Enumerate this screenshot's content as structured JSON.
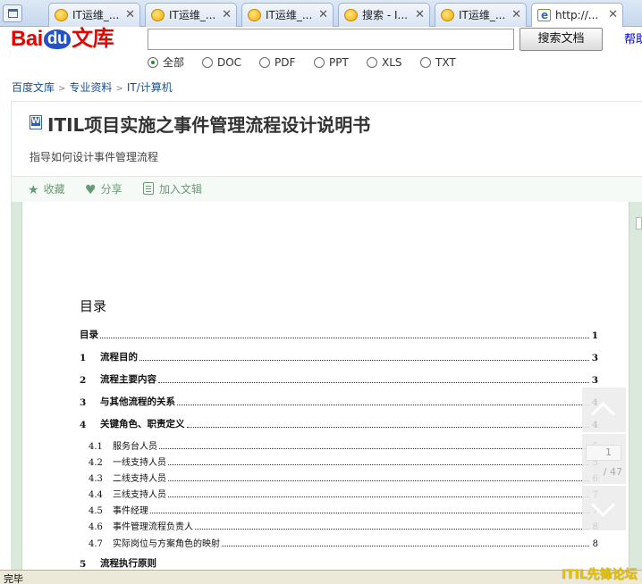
{
  "browser": {
    "tabs": [
      {
        "label": "IT运维_...",
        "icon": "baidu-paw-icon",
        "close": "✕"
      },
      {
        "label": "IT运维_...",
        "icon": "baidu-paw-icon",
        "close": "✕"
      },
      {
        "label": "IT运维_...",
        "icon": "baidu-paw-icon",
        "close": "✕"
      },
      {
        "label": "搜索 - I...",
        "icon": "baidu-paw-icon",
        "close": "✕"
      },
      {
        "label": "IT运维_...",
        "icon": "baidu-paw-icon",
        "close": "✕"
      },
      {
        "label": "http://...",
        "icon": "ie-page-icon",
        "close": "✕"
      }
    ],
    "status": "完毕"
  },
  "header": {
    "logo": {
      "bai": "Bai",
      "du": "du",
      "wenku": "文库"
    },
    "search": {
      "value": "",
      "button": "搜索文档"
    },
    "help": "帮助",
    "doc_types": [
      {
        "label": "全部",
        "selected": true
      },
      {
        "label": "DOC",
        "selected": false
      },
      {
        "label": "PDF",
        "selected": false
      },
      {
        "label": "PPT",
        "selected": false
      },
      {
        "label": "XLS",
        "selected": false
      },
      {
        "label": "TXT",
        "selected": false
      }
    ]
  },
  "breadcrumb": [
    "百度文库",
    "专业资料",
    "IT/计算机"
  ],
  "document": {
    "title": "ITIL项目实施之事件管理流程设计说明书",
    "subtitle": "指导如何设计事件管理流程",
    "actions": [
      {
        "label": "收藏",
        "icon": "star-icon"
      },
      {
        "label": "分享",
        "icon": "heart-icon"
      },
      {
        "label": "加入文辑",
        "icon": "clipboard-icon"
      }
    ]
  },
  "viewer": {
    "toc_heading": "目录",
    "toc": [
      {
        "num": "",
        "text": "目录",
        "page": "1",
        "level": 1
      },
      {
        "num": "1",
        "text": "流程目的",
        "page": "3",
        "level": 1
      },
      {
        "num": "2",
        "text": "流程主要内容",
        "page": "3",
        "level": 1
      },
      {
        "num": "3",
        "text": "与其他流程的关系",
        "page": "4",
        "level": 1
      },
      {
        "num": "4",
        "text": "关键角色、职责定义",
        "page": "4",
        "level": 1
      },
      {
        "num": "4.1",
        "text": "服务台人员",
        "page": "5",
        "level": 2
      },
      {
        "num": "4.2",
        "text": "一线支持人员",
        "page": "5",
        "level": 2
      },
      {
        "num": "4.3",
        "text": "二线支持人员",
        "page": "6",
        "level": 2
      },
      {
        "num": "4.4",
        "text": "三线支持人员",
        "page": "7",
        "level": 2
      },
      {
        "num": "4.5",
        "text": "事件经理",
        "page": "7",
        "level": 2
      },
      {
        "num": "4.6",
        "text": "事件管理流程负责人",
        "page": "8",
        "level": 2
      },
      {
        "num": "4.7",
        "text": "实际岗位与方案角色的映射",
        "page": "8",
        "level": 2
      },
      {
        "num": "5",
        "text": "流程执行原则",
        "page": "",
        "level": 1
      }
    ],
    "current_page": "1",
    "total_pages": "/ 47"
  },
  "watermark": "ITIL先锋论坛"
}
